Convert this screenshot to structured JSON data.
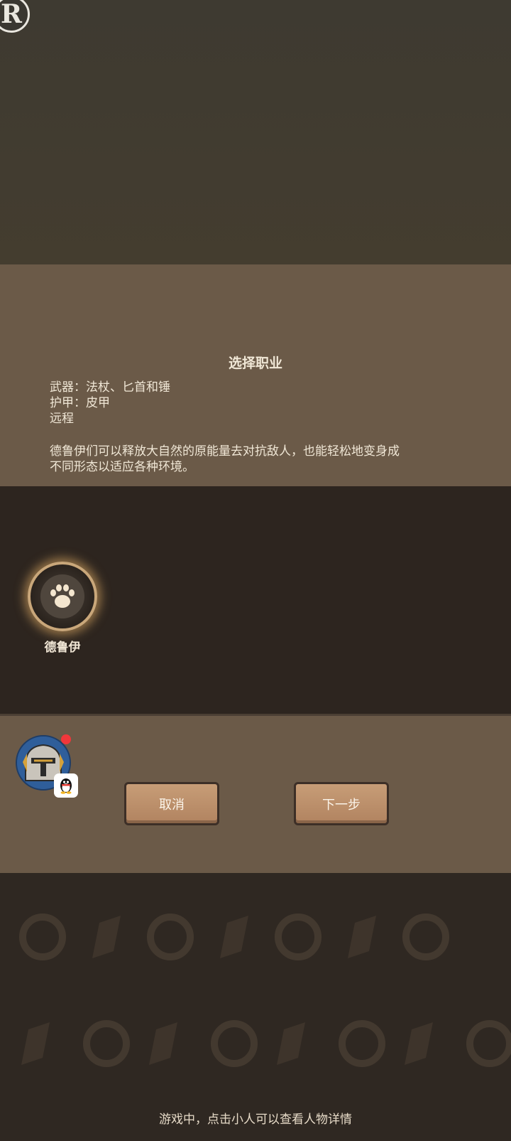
{
  "logo": {
    "letter": "R"
  },
  "dialog": {
    "title": "选择职业",
    "stats": [
      "武器：法杖、匕首和锤",
      "护甲：皮甲",
      "远程"
    ],
    "description_line1": "德鲁伊们可以释放大自然的原能量去对抗敌人，也能轻松地变身成",
    "description_line2": "不同形态以适应各种环境。"
  },
  "class_option": {
    "label": "德鲁伊",
    "icon": "paw-icon"
  },
  "player": {
    "avatar_icon": "knight-helmet-icon",
    "badge_icon": "qq-penguin-icon",
    "has_notification": true
  },
  "buttons": {
    "cancel": "取消",
    "next": "下一步"
  },
  "hint": "游戏中，点击小人可以查看人物详情",
  "colors": {
    "panel": "#6b5a48",
    "dark": "#2d251f",
    "button": "#c0916c",
    "glow": "#e0ab64",
    "notification": "#f0373b"
  }
}
